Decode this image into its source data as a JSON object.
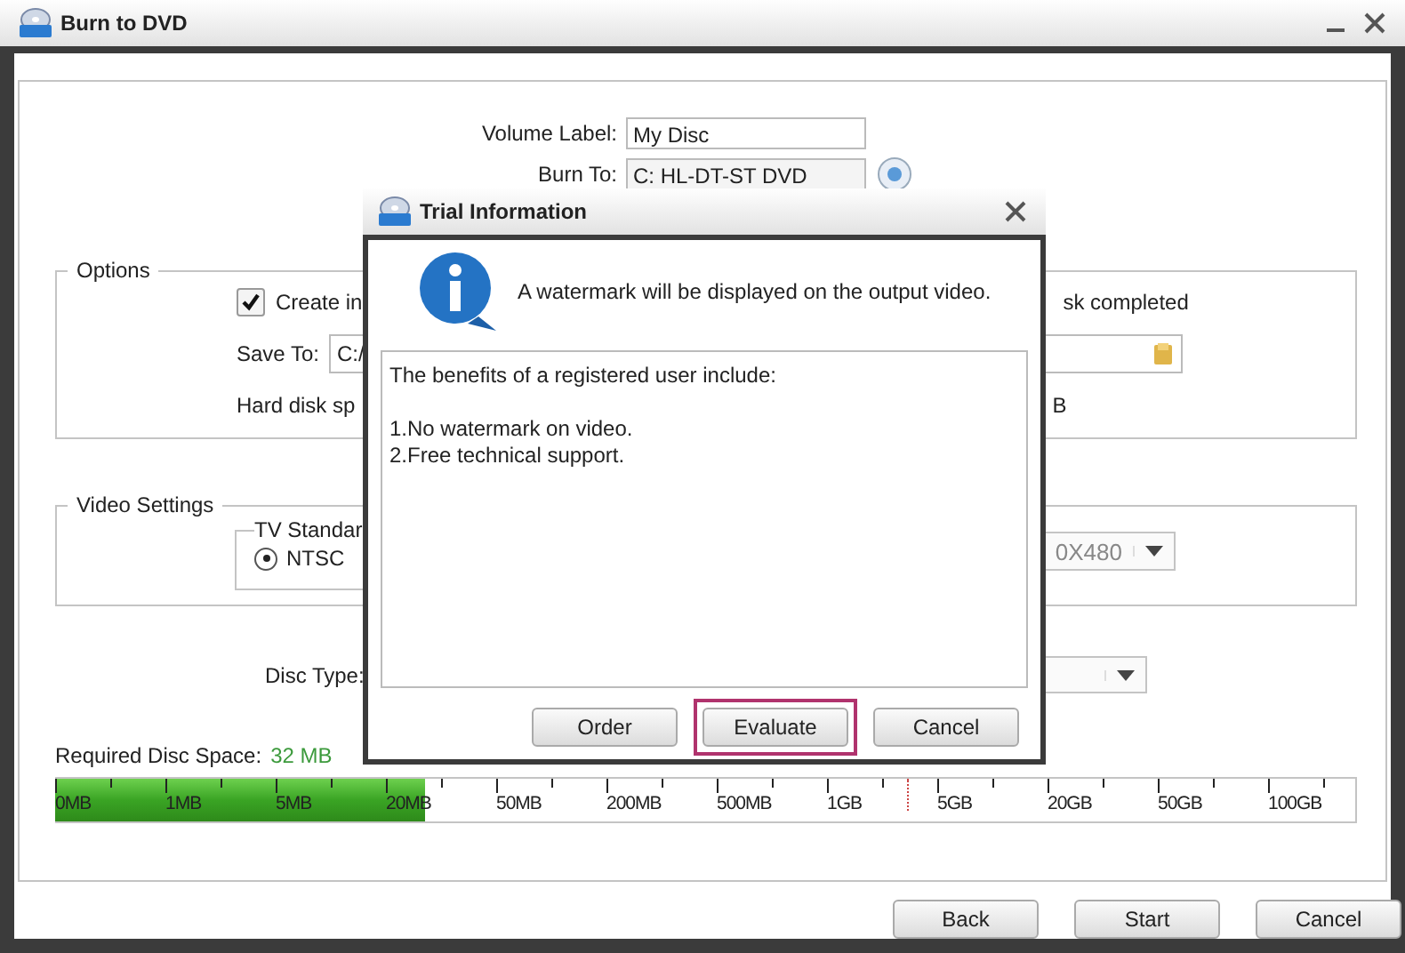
{
  "window": {
    "title": "Burn to DVD"
  },
  "volume_label": {
    "label": "Volume Label:",
    "value": "My Disc"
  },
  "burn_to": {
    "label": "Burn To:",
    "value": "C: HL-DT-ST DVD"
  },
  "options": {
    "title": "Options",
    "create_image": {
      "label": "Create in",
      "checked": true
    },
    "completed_text": "sk completed",
    "save_to": {
      "label": "Save To:",
      "value": "C:/"
    },
    "hard_disk": {
      "label": "Hard disk sp",
      "value": "B"
    }
  },
  "video_settings": {
    "title": "Video Settings",
    "tv_standard": {
      "title": "TV Standar",
      "options": [
        {
          "label": "NTSC",
          "selected": true
        }
      ]
    },
    "resolution": "0X480"
  },
  "disc_type": {
    "label": "Disc Type:"
  },
  "required_space": {
    "label": "Required Disc Space:",
    "value": "32 MB",
    "level": 0.285,
    "scale": [
      "0MB",
      "1MB",
      "5MB",
      "20MB",
      "50MB",
      "200MB",
      "500MB",
      "1GB",
      "5GB",
      "20GB",
      "50GB",
      "100GB"
    ]
  },
  "buttons": [
    {
      "label": "Back"
    },
    {
      "label": "Start"
    },
    {
      "label": "Cancel"
    }
  ],
  "dialog": {
    "title": "Trial Information",
    "message": "A watermark will be displayed on the output video.",
    "details": {
      "intro": "The benefits of a registered user include:",
      "items": [
        "1.No watermark on video.",
        "2.Free technical support."
      ]
    },
    "buttons": [
      {
        "label": "Order",
        "highlighted": false
      },
      {
        "label": "Evaluate",
        "highlighted": true
      },
      {
        "label": "Cancel",
        "highlighted": false
      }
    ]
  }
}
